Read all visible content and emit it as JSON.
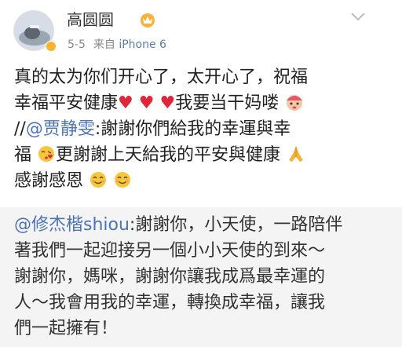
{
  "post": {
    "username": "高圆圆",
    "date": "5-5",
    "source_prefix": "来自",
    "source": "iPhone 6",
    "text_lines": [
      "真的太为你们开心了，太开心了，祝福",
      "幸福平安健康",
      "我要当干妈喽",
      "//",
      "@贾静雯",
      ":謝謝你們給我的幸運與幸",
      "福",
      "更謝謝上天給我的平安與健康",
      "感謝感恩"
    ]
  },
  "repost": {
    "mention": "@修杰楷shiou",
    "lines": [
      ":謝謝你，小天使，一路陪伴",
      "著我們一起迎接另一個小小天使的到來～",
      "謝謝你，媽咪，謝謝你讓我成爲最幸運的",
      "人～我會用我的幸運，轉換成幸福，讓我",
      "們一起擁有！"
    ]
  },
  "icons": {
    "avatar": "avatar-image",
    "verified": "verified-badge-icon",
    "vip": "vip-crown-icon",
    "more": "chevron-down-icon",
    "heart": "red-heart-emoji",
    "baby": "baby-face-emoji",
    "kiss": "kissing-face-emoji",
    "pray": "praying-hands-emoji",
    "smile": "smiling-face-emoji"
  },
  "colors": {
    "mention": "#4d74b5",
    "meta_gray": "#888888",
    "heart_red": "#e0263b",
    "repost_bg": "#f4f4f4"
  }
}
